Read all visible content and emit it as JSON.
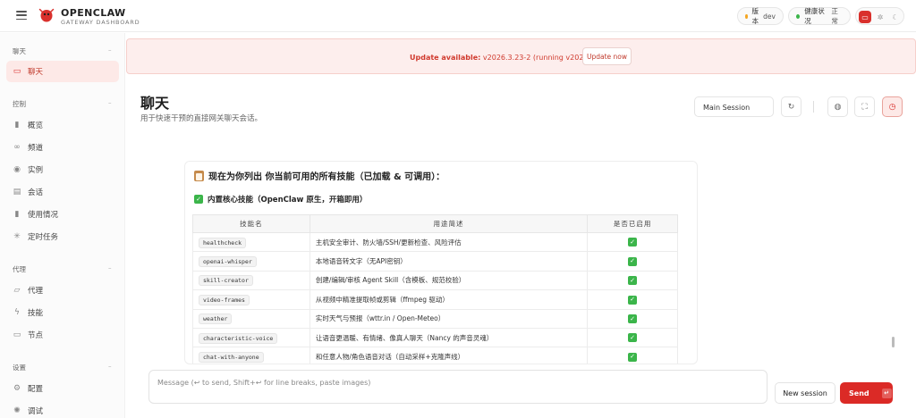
{
  "brand": {
    "title": "OPENCLAW",
    "subtitle": "GATEWAY DASHBOARD"
  },
  "topbar": {
    "version_label": "版本",
    "version_value": "dev",
    "health_label": "健康状况",
    "health_value": "正常",
    "colors": {
      "version_dot": "#f5a623",
      "health_dot": "#3bb54a",
      "accent": "#d9302c"
    }
  },
  "sidebar": {
    "sections": [
      {
        "title": "聊天",
        "items": [
          {
            "label": "聊天",
            "icon": "chat-bubble-icon",
            "active": true
          }
        ]
      },
      {
        "title": "控制",
        "items": [
          {
            "label": "概览",
            "icon": "bar-chart-icon"
          },
          {
            "label": "频道",
            "icon": "link-icon"
          },
          {
            "label": "实例",
            "icon": "broadcast-icon"
          },
          {
            "label": "会话",
            "icon": "document-icon"
          },
          {
            "label": "使用情况",
            "icon": "bar-chart-icon"
          },
          {
            "label": "定时任务",
            "icon": "loader-icon"
          }
        ]
      },
      {
        "title": "代理",
        "items": [
          {
            "label": "代理",
            "icon": "folder-icon"
          },
          {
            "label": "技能",
            "icon": "bolt-icon"
          },
          {
            "label": "节点",
            "icon": "monitor-icon"
          }
        ]
      },
      {
        "title": "设置",
        "items": [
          {
            "label": "配置",
            "icon": "gear-icon"
          },
          {
            "label": "调试",
            "icon": "bug-icon"
          }
        ]
      }
    ]
  },
  "banner": {
    "label": "Update available:",
    "detail": "v2026.3.23-2 (running v2026.3.1).",
    "button": "Update now"
  },
  "page": {
    "title": "聊天",
    "subtitle": "用于快速干预的直接网关聊天会话。"
  },
  "toolbar": {
    "session": "Main Session"
  },
  "message": {
    "heading": "现在为你列出 你当前可用的所有技能（已加载 & 可调用）：",
    "subheading": "内置核心技能（OpenClaw 原生，开箱即用）",
    "columns": [
      "技能名",
      "用途简述",
      "是否已启用"
    ],
    "rows": [
      {
        "name": "healthcheck",
        "desc": "主机安全审计、防火墙/SSH/更新检查、风险评估",
        "enabled": "✓"
      },
      {
        "name": "openai-whisper",
        "desc": "本地语音转文字（无API密钥）",
        "enabled": "✓"
      },
      {
        "name": "skill-creator",
        "desc": "创建/编辑/审核 Agent Skill（含模板、规范校验）",
        "enabled": "✓"
      },
      {
        "name": "video-frames",
        "desc": "从视频中精准提取帧或剪辑（ffmpeg 驱动）",
        "enabled": "✓"
      },
      {
        "name": "weather",
        "desc": "实时天气与预报（wttr.in / Open-Meteo）",
        "enabled": "✓"
      },
      {
        "name": "characteristic-voice",
        "desc": "让语音更温暖、有情绪、像真人聊天（Nancy 的声音灵魂）",
        "enabled": "✓"
      },
      {
        "name": "chat-with-anyone",
        "desc": "和任意人物/角色语音对话（自动采样+克隆声线）",
        "enabled": "✓"
      }
    ]
  },
  "composer": {
    "placeholder": "Message (↩ to send, Shift+↩ for line breaks, paste images)",
    "new_session": "New session",
    "send": "Send"
  }
}
